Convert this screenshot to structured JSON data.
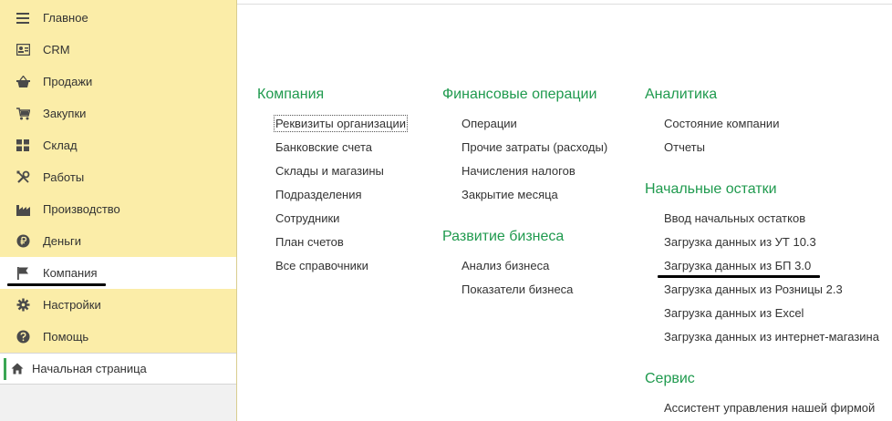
{
  "sidebar": {
    "items": [
      {
        "label": "Главное",
        "icon": "menu-lines-icon"
      },
      {
        "label": "CRM",
        "icon": "contact-card-icon"
      },
      {
        "label": "Продажи",
        "icon": "basket-icon"
      },
      {
        "label": "Закупки",
        "icon": "cart-icon"
      },
      {
        "label": "Склад",
        "icon": "warehouse-grid-icon"
      },
      {
        "label": "Работы",
        "icon": "tools-icon"
      },
      {
        "label": "Производство",
        "icon": "factory-icon"
      },
      {
        "label": "Деньги",
        "icon": "ruble-coin-icon"
      },
      {
        "label": "Компания",
        "icon": "flag-icon"
      },
      {
        "label": "Настройки",
        "icon": "gear-icon"
      },
      {
        "label": "Помощь",
        "icon": "question-icon"
      }
    ],
    "active_index": 8,
    "home": {
      "label": "Начальная страница",
      "icon": "home-icon"
    }
  },
  "sections": {
    "company": {
      "title": "Компания",
      "links": [
        "Реквизиты организации",
        "Банковские счета",
        "Склады и магазины",
        "Подразделения",
        "Сотрудники",
        "План счетов",
        "Все справочники"
      ]
    },
    "finance": {
      "title": "Финансовые операции",
      "links": [
        "Операции",
        "Прочие затраты (расходы)",
        "Начисления налогов",
        "Закрытие месяца"
      ]
    },
    "business": {
      "title": "Развитие бизнеса",
      "links": [
        "Анализ бизнеса",
        "Показатели бизнеса"
      ]
    },
    "analytics": {
      "title": "Аналитика",
      "links": [
        "Состояние компании",
        "Отчеты"
      ]
    },
    "opening": {
      "title": "Начальные остатки",
      "links": [
        "Ввод начальных остатков",
        "Загрузка данных из УТ 10.3",
        "Загрузка данных из БП 3.0",
        "Загрузка данных из Розницы 2.3",
        "Загрузка данных из Excel",
        "Загрузка данных из интернет-магазина"
      ]
    },
    "service": {
      "title": "Сервис",
      "links": [
        "Ассистент управления нашей фирмой"
      ]
    }
  },
  "colors": {
    "sidebar_bg": "#fbeda8",
    "section_title": "#1f9a4e",
    "home_accent": "#3aa654"
  }
}
